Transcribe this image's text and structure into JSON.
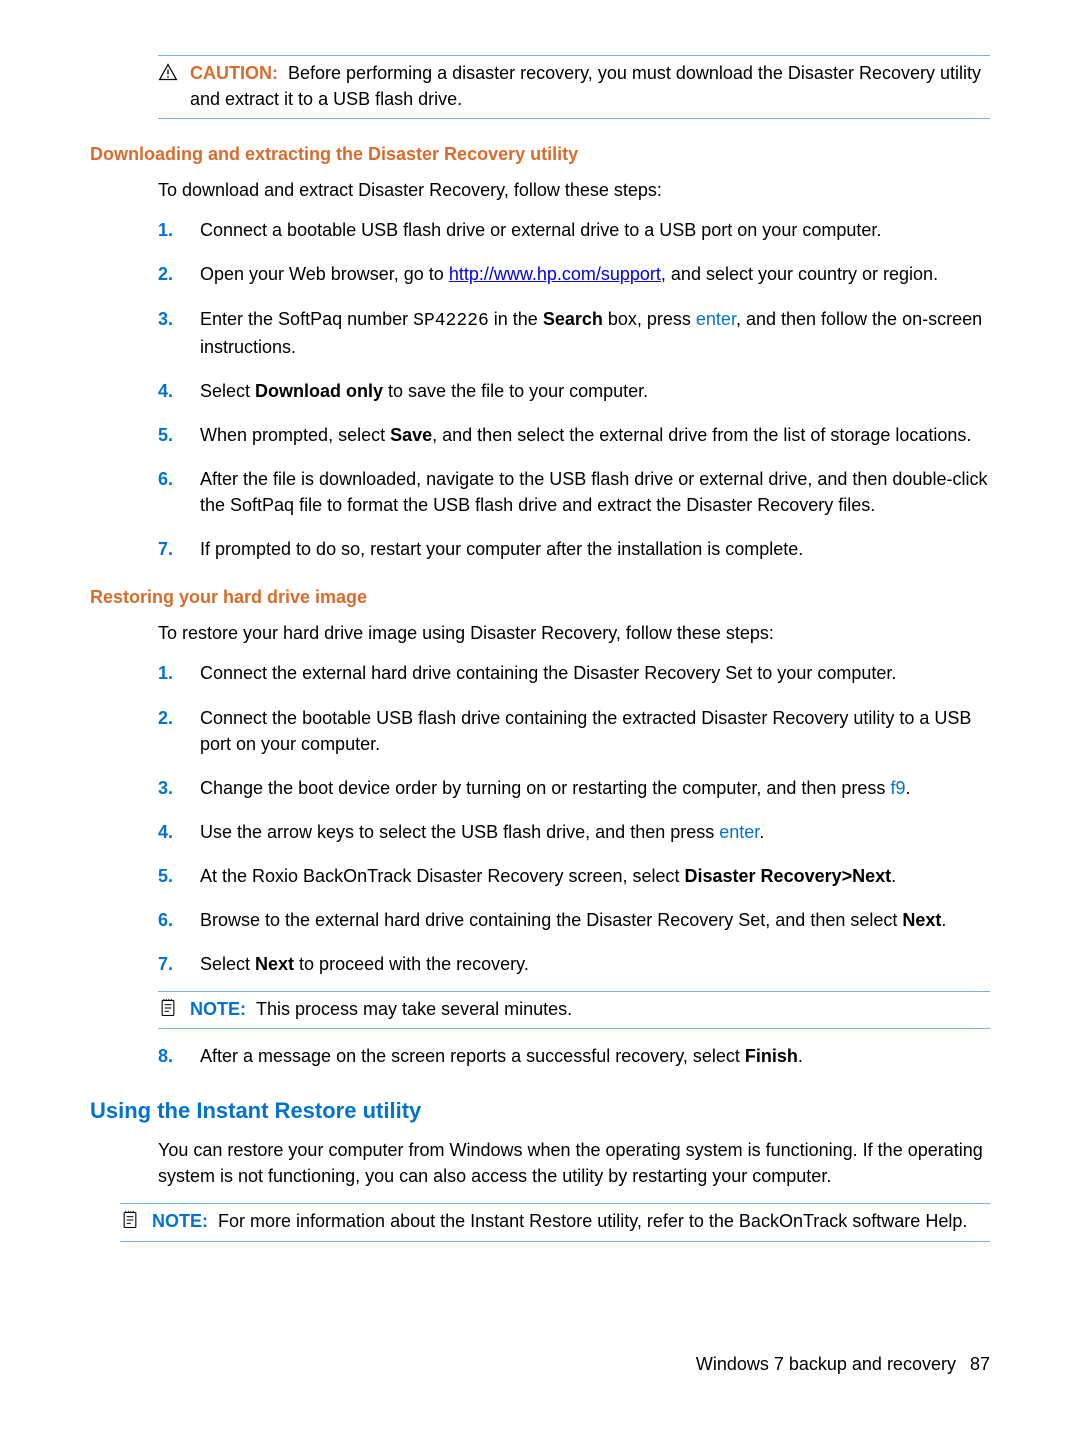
{
  "callouts": {
    "caution": {
      "label": "CAUTION:",
      "text": "Before performing a disaster recovery, you must download the Disaster Recovery utility and extract it to a USB flash drive."
    },
    "note1": {
      "label": "NOTE:",
      "text": "This process may take several minutes."
    },
    "note2": {
      "label": "NOTE:",
      "text": "For more information about the Instant Restore utility, refer to the BackOnTrack software Help."
    }
  },
  "sections": {
    "s1": {
      "title": "Downloading and extracting the Disaster Recovery utility",
      "intro": "To download and extract Disaster Recovery, follow these steps:",
      "steps": [
        {
          "n": "1.",
          "pre": "Connect a bootable USB flash drive or external drive to a USB port on your computer."
        },
        {
          "n": "2.",
          "pre": "Open your Web browser, go to ",
          "link": "http://www.hp.com/support",
          "post": ", and select your country or region."
        },
        {
          "n": "3.",
          "pre": "Enter the SoftPaq number ",
          "code": "SP42226",
          "mid": " in the ",
          "bold": "Search",
          "mid2": " box, press ",
          "key": "enter",
          "post": ", and then follow the on-screen instructions."
        },
        {
          "n": "4.",
          "pre": "Select ",
          "bold": "Download only",
          "post": " to save the file to your computer."
        },
        {
          "n": "5.",
          "pre": "When prompted, select ",
          "bold": "Save",
          "post": ", and then select the external drive from the list of storage locations."
        },
        {
          "n": "6.",
          "pre": "After the file is downloaded, navigate to the USB flash drive or external drive, and then double-click the SoftPaq file to format the USB flash drive and extract the Disaster Recovery files."
        },
        {
          "n": "7.",
          "pre": "If prompted to do so, restart your computer after the installation is complete."
        }
      ]
    },
    "s2": {
      "title": "Restoring your hard drive image",
      "intro": "To restore your hard drive image using Disaster Recovery, follow these steps:",
      "steps": [
        {
          "n": "1.",
          "pre": "Connect the external hard drive containing the Disaster Recovery Set to your computer."
        },
        {
          "n": "2.",
          "pre": "Connect the bootable USB flash drive containing the extracted Disaster Recovery utility to a USB port on your computer."
        },
        {
          "n": "3.",
          "pre": "Change the boot device order by turning on or restarting the computer, and then press ",
          "key": "f9",
          "post": "."
        },
        {
          "n": "4.",
          "pre": "Use the arrow keys to select the USB flash drive, and then press ",
          "key": "enter",
          "post": "."
        },
        {
          "n": "5.",
          "pre": "At the Roxio BackOnTrack Disaster Recovery screen, select ",
          "bold": "Disaster Recovery>Next",
          "post": "."
        },
        {
          "n": "6.",
          "pre": "Browse to the external hard drive containing the Disaster Recovery Set, and then select ",
          "bold": "Next",
          "post": "."
        },
        {
          "n": "7.",
          "pre": "Select ",
          "bold": "Next",
          "post": " to proceed with the recovery."
        },
        {
          "n": "8.",
          "pre": "After a message on the screen reports a successful recovery, select ",
          "bold": "Finish",
          "post": "."
        }
      ]
    },
    "s3": {
      "title": "Using the Instant Restore utility",
      "intro": "You can restore your computer from Windows when the operating system is functioning. If the operating system is not functioning, you can also access the utility by restarting your computer."
    }
  },
  "footer": {
    "text": "Windows 7 backup and recovery",
    "page": "87"
  }
}
